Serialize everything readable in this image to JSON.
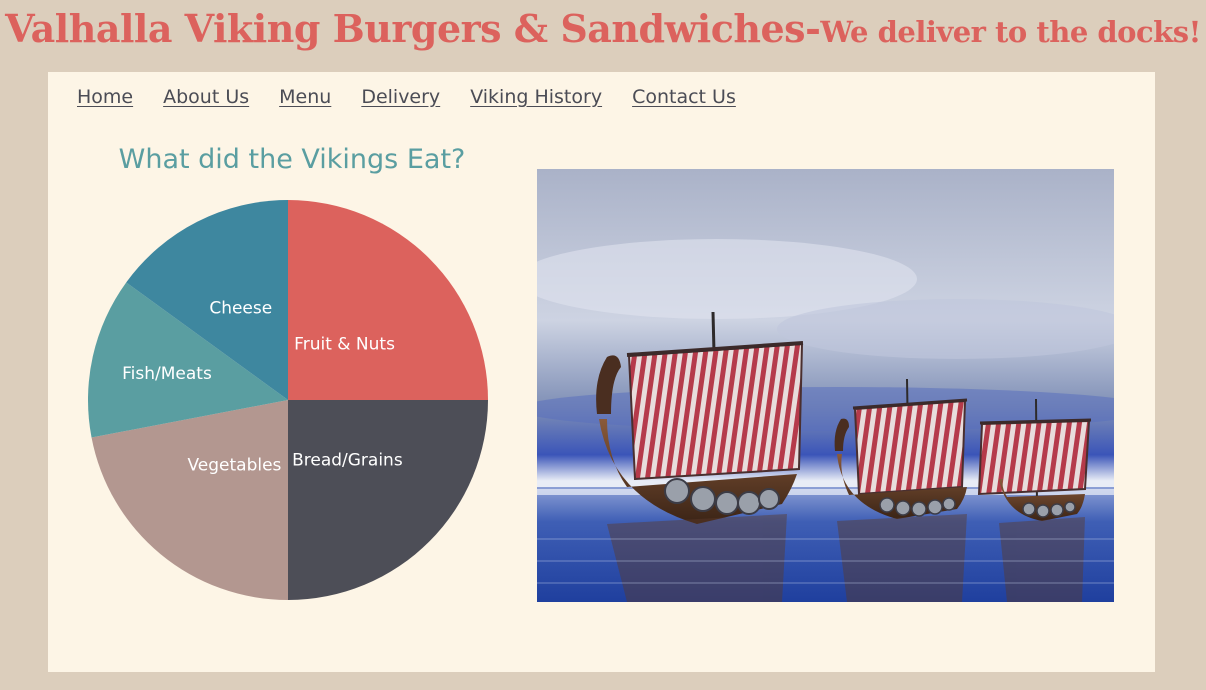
{
  "header": {
    "title": "Valhalla Viking Burgers & Sandwiches-",
    "tagline": "We deliver to the docks!"
  },
  "nav": {
    "items": [
      {
        "label": "Home"
      },
      {
        "label": "About Us"
      },
      {
        "label": "Menu"
      },
      {
        "label": "Delivery"
      },
      {
        "label": "Viking History"
      },
      {
        "label": "Contact Us"
      }
    ]
  },
  "chart_data": {
    "type": "pie",
    "title": "What did the Vikings Eat?",
    "slices": [
      {
        "label": "Fruit & Nuts",
        "value": 25,
        "color": "#dc625d"
      },
      {
        "label": "Bread/Grains",
        "value": 25,
        "color": "#4d4e57"
      },
      {
        "label": "Vegetables",
        "value": 22,
        "color": "#b39790"
      },
      {
        "label": "Fish/Meats",
        "value": 13,
        "color": "#5a9ea1"
      },
      {
        "label": "Cheese",
        "value": 15,
        "color": "#3e879f"
      }
    ],
    "legend": "none (labels inside slices)"
  },
  "image": {
    "subject": "viking-longships-on-water"
  },
  "colors": {
    "accent": "#dc625d",
    "page_background": "#dccebc",
    "panel_background": "#fdf5e6",
    "nav_text": "#4b4c55",
    "chart_title": "#5a9ea1"
  }
}
